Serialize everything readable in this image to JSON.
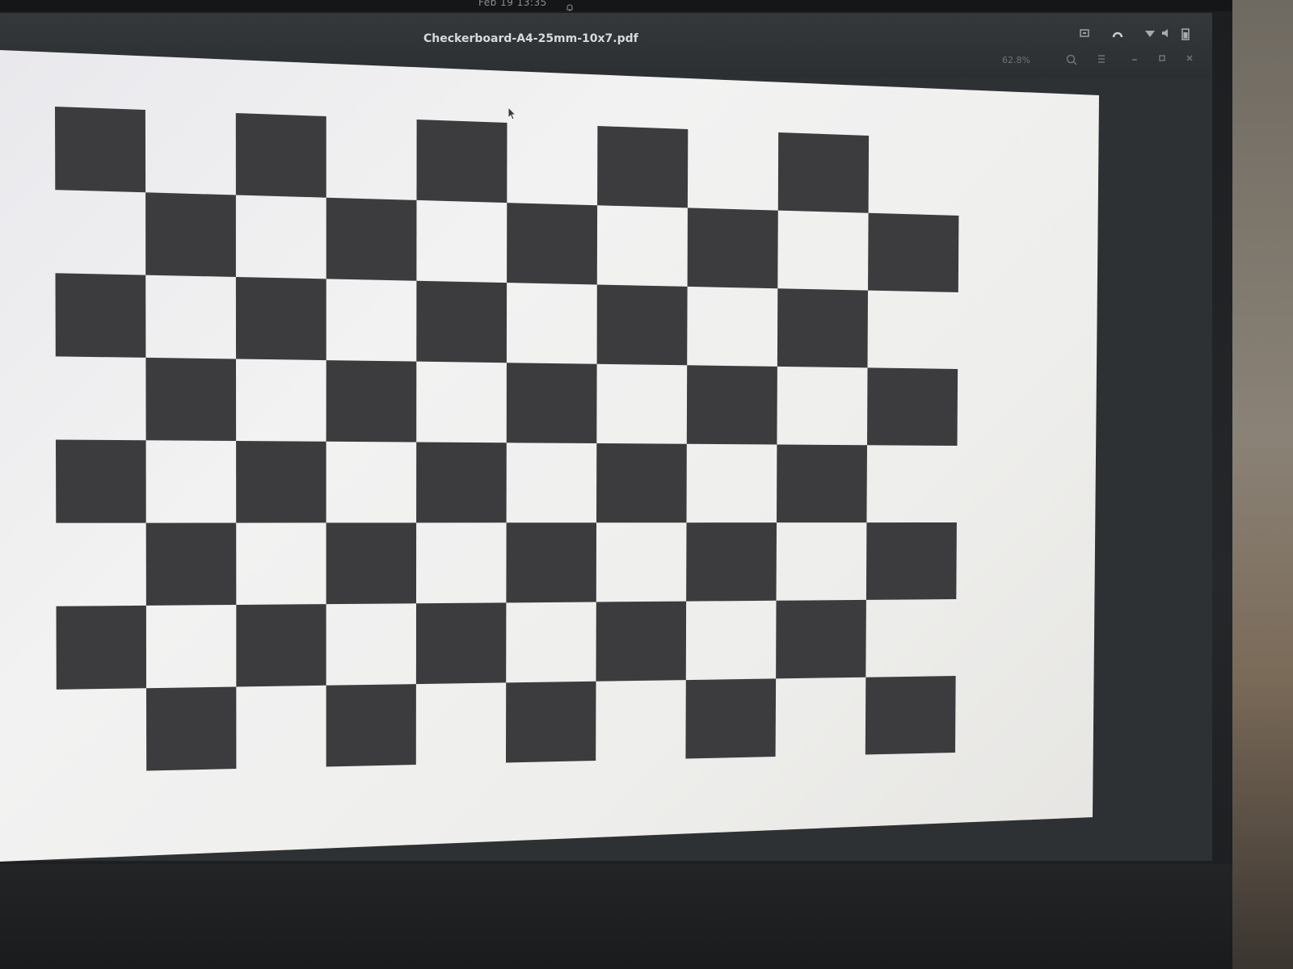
{
  "topbar": {
    "clock": "Feb 19  13:35",
    "bell_icon": "bell-icon"
  },
  "window": {
    "title": "Checkerboard-A4-25mm-10x7.pdf",
    "zoom": "62.8%",
    "tray_icons": [
      "network-icon",
      "upload-icon",
      "wifi-icon",
      "volume-icon",
      "battery-icon"
    ],
    "header_buttons": [
      "search-icon",
      "menu-icon",
      "minimize-icon",
      "maximize-icon",
      "close-icon"
    ]
  },
  "document": {
    "pattern": "checkerboard",
    "columns": 10,
    "rows": 8,
    "dark_color": "#3c3c3e",
    "light_color": "#f0f0f0"
  },
  "colors": {
    "headerbar": "#2e3134",
    "title_text": "#d7d9db"
  }
}
